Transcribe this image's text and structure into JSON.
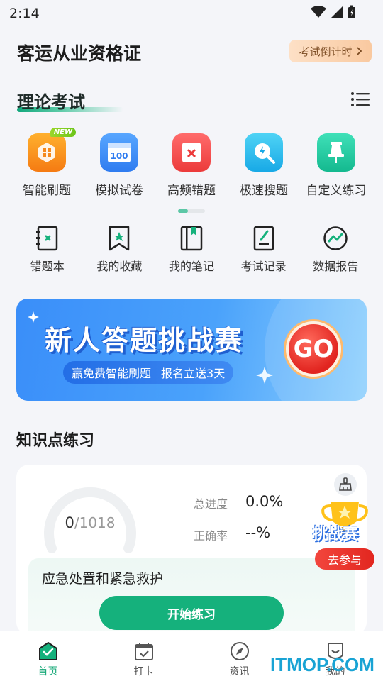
{
  "status": {
    "time": "2:14"
  },
  "header": {
    "title": "客运从业资格证",
    "countdown_label": "考试倒计时"
  },
  "section": {
    "title": "理论考试"
  },
  "features": [
    {
      "label": "智能刷题",
      "icon": "smart-practice-icon",
      "badge": "NEW"
    },
    {
      "label": "模拟试卷",
      "icon": "mock-exam-icon",
      "icon_text": "100"
    },
    {
      "label": "高频错题",
      "icon": "frequent-mistakes-icon"
    },
    {
      "label": "极速搜题",
      "icon": "quick-search-icon"
    },
    {
      "label": "自定义练习",
      "icon": "custom-practice-icon"
    }
  ],
  "tools": [
    {
      "label": "错题本",
      "icon": "mistake-book-icon"
    },
    {
      "label": "我的收藏",
      "icon": "bookmark-icon"
    },
    {
      "label": "我的笔记",
      "icon": "notes-icon"
    },
    {
      "label": "考试记录",
      "icon": "exam-record-icon"
    },
    {
      "label": "数据报告",
      "icon": "data-report-icon"
    }
  ],
  "banner": {
    "title": "新人答题挑战赛",
    "sub_left": "赢免费智能刷题",
    "sub_right": "报名立送3天",
    "go_label": "GO"
  },
  "knowledge": {
    "title": "知识点练习",
    "done": "0",
    "total": "/1018",
    "progress_label": "总进度",
    "progress_value": "0.0%",
    "accuracy_label": "正确率",
    "accuracy_value": "--%",
    "topic": "应急处置和紧急救护",
    "start_label": "开始练习"
  },
  "challenge": {
    "title": "挑战赛",
    "join_label": "去参与"
  },
  "nav": [
    {
      "label": "首页",
      "icon": "home-icon",
      "active": true
    },
    {
      "label": "打卡",
      "icon": "calendar-check-icon"
    },
    {
      "label": "资讯",
      "icon": "compass-icon"
    },
    {
      "label": "我的",
      "icon": "profile-icon"
    }
  ],
  "watermark": "ITMOP.COM",
  "colors": {
    "accent": "#15b17c",
    "banner": "#3a8ef9",
    "go": "#e1241f"
  }
}
